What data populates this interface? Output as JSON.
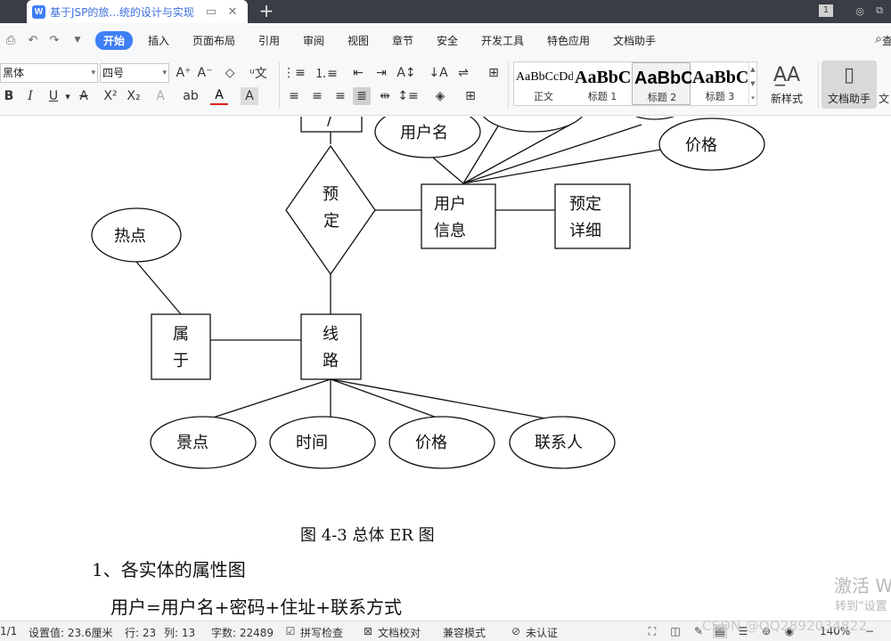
{
  "tabbar": {
    "doc_title": "基于JSP的旅...统的设计与实现",
    "new_tab": "+",
    "page_indicator": "1"
  },
  "menubar": {
    "items": [
      "开始",
      "插入",
      "页面布局",
      "引用",
      "审阅",
      "视图",
      "章节",
      "安全",
      "开发工具",
      "特色应用",
      "文档助手"
    ],
    "active": "开始",
    "search_text": "查"
  },
  "ribbon": {
    "font_name": "黑体",
    "font_size": "四号",
    "styles": [
      {
        "sample": "AaBbCcDd",
        "name": "正文"
      },
      {
        "sample": "AaBbC",
        "name": "标题 1"
      },
      {
        "sample": "AaBbC",
        "name": "标题 2"
      },
      {
        "sample": "AaBbC",
        "name": "标题 3"
      }
    ],
    "new_style": "新样式",
    "doc_assistant": "文档助手",
    "cut_off_label": "文"
  },
  "er": {
    "attributes": [
      "用户名",
      "价格",
      "热点",
      "景点",
      "时间",
      "价格",
      "联系人"
    ],
    "relationships": [
      "预定"
    ],
    "entities": {
      "user_info": [
        "用户",
        "信息"
      ],
      "booking_detail": [
        "预定",
        "详细"
      ],
      "belongs": [
        "属",
        "于"
      ],
      "route": [
        "线",
        "路"
      ]
    },
    "top_clipped_entity": "/"
  },
  "document": {
    "caption": "图 4-3 总体 ER 图",
    "heading": "1、各实体的属性图",
    "body_line": "用户=用户名+密码+住址+联系方式"
  },
  "overlay": {
    "activate_title": "激活 W",
    "activate_sub": "转到“设置",
    "watermark": "CSDN @QQ2892034822"
  },
  "statusbar": {
    "page": "1/1",
    "position": "设置值: 23.6厘米",
    "line": "行: 23",
    "column": "列: 13",
    "word_count": "字数: 22489",
    "spell_check": "拼写检查",
    "doc_proof": "文档校对",
    "compat_mode": "兼容模式",
    "certification": "未认证",
    "zoom": "140%"
  },
  "colors": {
    "accent": "#3d7ff5",
    "tabbar_bg": "#3a3d46",
    "ribbon_bg": "#f7f8fa"
  }
}
